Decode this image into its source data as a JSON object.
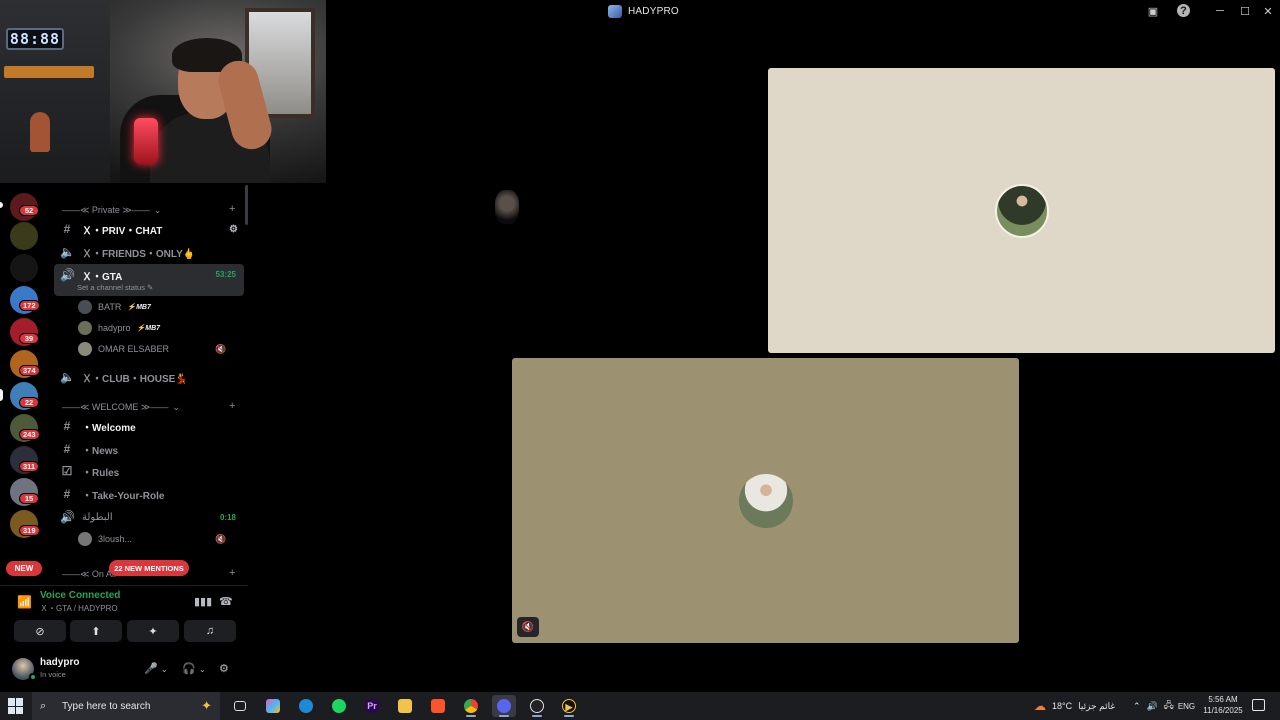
{
  "window": {
    "title": "HADYPRO"
  },
  "webcam": {
    "clock": "88:88"
  },
  "servers": [
    {
      "badge": "52",
      "color": "#5a1a1e"
    },
    {
      "badge": "",
      "color": "#3b3a1a"
    },
    {
      "badge": "",
      "color": "#151515"
    },
    {
      "badge": "172",
      "color": "#3b78c8"
    },
    {
      "badge": "39",
      "color": "#a31d2a"
    },
    {
      "badge": "374",
      "color": "#b0661f"
    },
    {
      "badge": "22",
      "color": "#3e7fb8"
    },
    {
      "badge": "243",
      "color": "#4d5a3a"
    },
    {
      "badge": "311",
      "color": "#2c2f3a"
    },
    {
      "badge": "15",
      "color": "#6e7480"
    },
    {
      "badge": "319",
      "color": "#7a5a1e"
    }
  ],
  "new_label": "NEW",
  "categories": {
    "private": "——≪ Private ≫——",
    "welcome": "——≪ WELCOME ≫——",
    "on_air": "——≪ On Air"
  },
  "channels": {
    "priv_chat": "Ｘ・PRIV・CHAT",
    "friends_only": "Ｘ・FRIENDS・ONLY🖕",
    "gta": "Ｘ・GTA",
    "gta_time": "53:25",
    "gta_status": "Set a channel status ✎",
    "club_house": "Ｘ・CLUB・HOUSE💃",
    "welcome": "・Welcome",
    "news": "・News",
    "rules": "・Rules",
    "take_your_role": "・Take-Your-Role",
    "batola": "البطولة",
    "batola_time": "0:18"
  },
  "members": [
    {
      "name": "BATR",
      "tag": "MB7"
    },
    {
      "name": "hadypro",
      "tag": "MB7"
    },
    {
      "name": "OMAR ELSABER",
      "tag": ""
    },
    {
      "name": "3loush...",
      "tag": ""
    }
  ],
  "mentions": "22 NEW MENTIONS",
  "voice": {
    "title": "Voice Connected",
    "subtitle": "Ｘ・GTA / HADYPRO"
  },
  "user": {
    "name": "hadypro",
    "status": "In voice"
  },
  "taskbar": {
    "search_placeholder": "Type here to search",
    "weather": "18°C",
    "weather_text": "غائم جزئيا",
    "lang": "ENG",
    "time": "5:56 AM",
    "date": "11/16/2025"
  },
  "colors": {
    "accent_green": "#23a55a",
    "mention_red": "#da373c",
    "tile_main": "#dfd8c8",
    "tile_second": "#9c9272"
  }
}
